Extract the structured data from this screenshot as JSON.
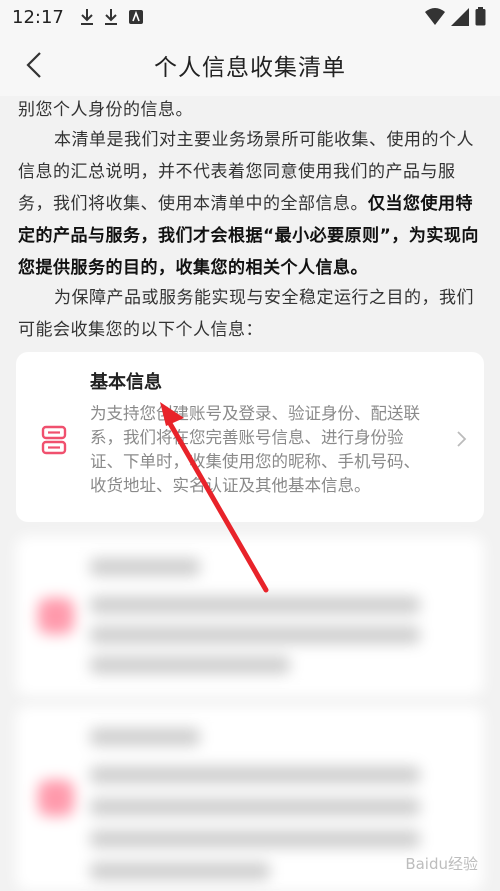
{
  "status_bar": {
    "time": "12:17"
  },
  "header": {
    "title": "个人信息收集清单"
  },
  "content": {
    "line1": "别您个人身份的信息。",
    "para2_normal": "本清单是我们对主要业务场景所可能收集、使用的个人信息的汇总说明，并不代表着您同意使用我们的产品与服务，我们将收集、使用本清单中的全部信息。",
    "para2_bold": "仅当您使用特定的产品与服务，我们才会根据“最小必要原则”，为实现向您提供服务的目的，收集您的相关个人信息。",
    "para3": "为保障产品或服务能实现与安全稳定运行之目的，我们可能会收集您的以下个人信息："
  },
  "card": {
    "title": "基本信息",
    "description": "为支持您创建账号及登录、验证身份、配送联系，我们将在您完善账号信息、进行身份验证、下单时，收集使用您的昵称、手机号码、收货地址、实名认证及其他基本信息。",
    "icon": "id-card-icon",
    "accent_color": "#f0506e"
  },
  "watermark": {
    "text": "Baidu经验"
  }
}
